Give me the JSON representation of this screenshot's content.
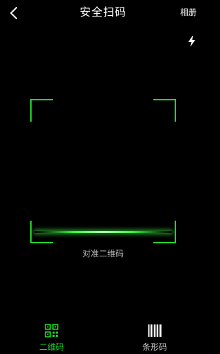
{
  "header": {
    "title": "安全扫码",
    "album_label": "相册",
    "back_icon": "chevron-left-icon",
    "flash_icon": "flash-icon"
  },
  "scanner": {
    "hint": "对准二维码",
    "accent_color": "#22d62a"
  },
  "tabs": [
    {
      "label": "二维码",
      "icon": "qr-code-icon",
      "active": true
    },
    {
      "label": "条形码",
      "icon": "barcode-icon",
      "active": false
    }
  ]
}
